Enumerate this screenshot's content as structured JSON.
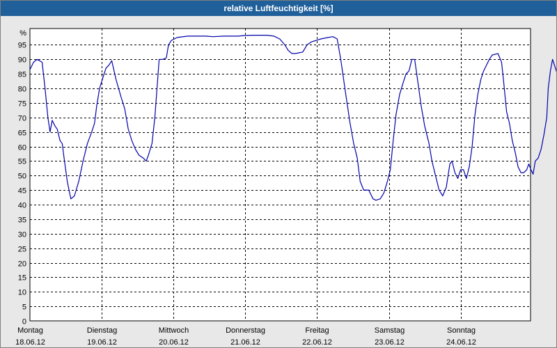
{
  "window": {
    "title": "relative Luftfeuchtigkeit [%]"
  },
  "colors": {
    "line": "#0000aa",
    "grid": "#000000",
    "plot_bg": "#ffffff",
    "title_bg": "#1f5f9a"
  },
  "chart_data": {
    "type": "line",
    "title": "relative Luftfeuchtigkeit [%]",
    "ylabel": "%",
    "ylim": [
      0,
      100
    ],
    "yticks": [
      0,
      5,
      10,
      15,
      20,
      25,
      30,
      35,
      40,
      45,
      50,
      55,
      60,
      65,
      70,
      75,
      80,
      85,
      90,
      95
    ],
    "xlim": [
      0,
      7
    ],
    "x_unit": "days since Montag 18.06.12",
    "grid": true,
    "xticks": [
      {
        "day": "Montag",
        "date": "18.06.12",
        "x": 0
      },
      {
        "day": "Dienstag",
        "date": "19.06.12",
        "x": 1
      },
      {
        "day": "Mittwoch",
        "date": "20.06.12",
        "x": 2
      },
      {
        "day": "Donnerstag",
        "date": "21.06.12",
        "x": 3
      },
      {
        "day": "Freitag",
        "date": "22.06.12",
        "x": 4
      },
      {
        "day": "Samstag",
        "date": "23.06.12",
        "x": 5
      },
      {
        "day": "Sonntag",
        "date": "24.06.12",
        "x": 6
      }
    ],
    "series": [
      {
        "name": "",
        "points": [
          [
            0.0,
            86.5
          ],
          [
            0.05,
            89
          ],
          [
            0.1,
            90
          ],
          [
            0.17,
            89
          ],
          [
            0.21,
            80
          ],
          [
            0.25,
            70
          ],
          [
            0.28,
            65
          ],
          [
            0.31,
            69
          ],
          [
            0.35,
            67
          ],
          [
            0.38,
            66
          ],
          [
            0.42,
            62
          ],
          [
            0.45,
            61
          ],
          [
            0.47,
            57
          ],
          [
            0.52,
            48
          ],
          [
            0.57,
            42
          ],
          [
            0.62,
            43
          ],
          [
            0.68,
            48
          ],
          [
            0.74,
            55
          ],
          [
            0.8,
            61
          ],
          [
            0.86,
            65
          ],
          [
            0.9,
            68
          ],
          [
            0.93,
            74
          ],
          [
            0.97,
            80
          ],
          [
            1.02,
            84
          ],
          [
            1.06,
            87
          ],
          [
            1.1,
            88
          ],
          [
            1.14,
            89.5
          ],
          [
            1.2,
            83
          ],
          [
            1.27,
            77
          ],
          [
            1.32,
            73
          ],
          [
            1.37,
            66
          ],
          [
            1.42,
            62
          ],
          [
            1.47,
            59
          ],
          [
            1.52,
            57
          ],
          [
            1.58,
            56
          ],
          [
            1.62,
            55
          ],
          [
            1.65,
            57
          ],
          [
            1.7,
            61
          ],
          [
            1.74,
            70
          ],
          [
            1.77,
            80
          ],
          [
            1.8,
            90
          ],
          [
            1.85,
            90
          ],
          [
            1.9,
            90.5
          ],
          [
            1.93,
            95
          ],
          [
            1.97,
            96.5
          ],
          [
            2.05,
            97.5
          ],
          [
            2.2,
            98
          ],
          [
            2.35,
            98
          ],
          [
            2.45,
            98
          ],
          [
            2.55,
            97.8
          ],
          [
            2.7,
            98
          ],
          [
            2.9,
            98
          ],
          [
            3.0,
            98.2
          ],
          [
            3.1,
            98.3
          ],
          [
            3.3,
            98.3
          ],
          [
            3.4,
            98
          ],
          [
            3.48,
            97
          ],
          [
            3.55,
            95
          ],
          [
            3.6,
            93
          ],
          [
            3.65,
            92
          ],
          [
            3.7,
            92
          ],
          [
            3.8,
            92.5
          ],
          [
            3.86,
            95
          ],
          [
            3.92,
            96
          ],
          [
            4.05,
            97
          ],
          [
            4.15,
            97.5
          ],
          [
            4.22,
            97.8
          ],
          [
            4.28,
            97
          ],
          [
            4.33,
            90
          ],
          [
            4.4,
            78
          ],
          [
            4.46,
            68
          ],
          [
            4.51,
            61
          ],
          [
            4.56,
            56
          ],
          [
            4.6,
            48
          ],
          [
            4.65,
            45
          ],
          [
            4.72,
            45
          ],
          [
            4.78,
            42
          ],
          [
            4.82,
            41.5
          ],
          [
            4.88,
            42
          ],
          [
            4.93,
            44
          ],
          [
            4.98,
            48
          ],
          [
            5.02,
            52
          ],
          [
            5.06,
            62
          ],
          [
            5.1,
            71
          ],
          [
            5.15,
            78
          ],
          [
            5.2,
            82
          ],
          [
            5.24,
            85
          ],
          [
            5.28,
            86
          ],
          [
            5.32,
            90
          ],
          [
            5.36,
            90
          ],
          [
            5.4,
            83
          ],
          [
            5.45,
            74
          ],
          [
            5.5,
            67
          ],
          [
            5.56,
            61
          ],
          [
            5.6,
            55
          ],
          [
            5.65,
            50
          ],
          [
            5.7,
            45
          ],
          [
            5.75,
            43
          ],
          [
            5.8,
            46
          ],
          [
            5.85,
            54
          ],
          [
            5.88,
            55
          ],
          [
            5.92,
            51
          ],
          [
            5.96,
            49
          ],
          [
            6.0,
            52
          ],
          [
            6.04,
            52
          ],
          [
            6.08,
            49
          ],
          [
            6.12,
            53
          ],
          [
            6.16,
            60
          ],
          [
            6.2,
            71
          ],
          [
            6.24,
            78
          ],
          [
            6.28,
            83
          ],
          [
            6.32,
            86
          ],
          [
            6.36,
            88
          ],
          [
            6.4,
            90
          ],
          [
            6.44,
            91.5
          ],
          [
            6.52,
            92
          ],
          [
            6.57,
            89
          ],
          [
            6.6,
            82
          ],
          [
            6.64,
            72
          ],
          [
            6.68,
            68
          ],
          [
            6.72,
            62
          ],
          [
            6.76,
            58
          ],
          [
            6.8,
            53
          ],
          [
            6.84,
            51
          ],
          [
            6.88,
            51
          ],
          [
            6.92,
            52
          ],
          [
            6.95,
            54
          ],
          [
            6.98,
            52
          ],
          [
            7.01,
            50.5
          ],
          [
            7.04,
            55
          ],
          [
            7.08,
            56
          ],
          [
            7.12,
            59
          ],
          [
            7.16,
            64
          ],
          [
            7.2,
            70
          ],
          [
            7.22,
            80
          ],
          [
            7.25,
            86
          ],
          [
            7.28,
            90
          ],
          [
            7.32,
            87
          ],
          [
            7.36,
            84
          ],
          [
            7.4,
            83
          ],
          [
            7.45,
            85
          ]
        ]
      }
    ]
  }
}
